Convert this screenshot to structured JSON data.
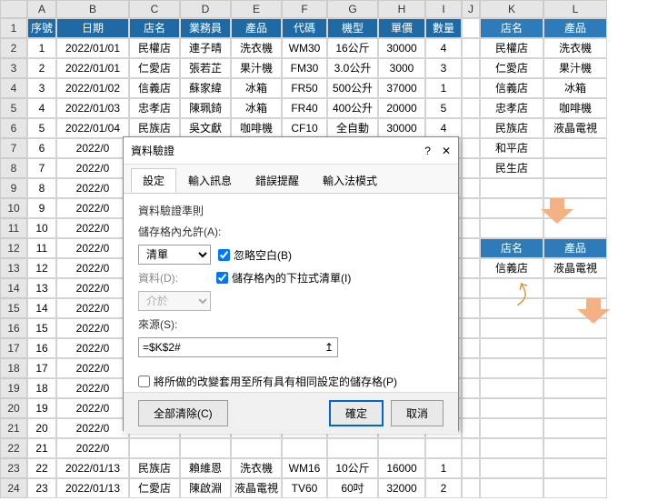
{
  "columns": [
    "A",
    "B",
    "C",
    "D",
    "E",
    "F",
    "G",
    "H",
    "I",
    "J",
    "K",
    "L"
  ],
  "headers": {
    "A": "序號",
    "B": "日期",
    "C": "店名",
    "D": "業務員",
    "E": "產品",
    "F": "代碼",
    "G": "機型",
    "H": "單價",
    "I": "數量"
  },
  "side_headers": {
    "K": "店名",
    "L": "產品"
  },
  "rows": [
    {
      "n": "1",
      "A": "1",
      "B": "2022/01/01",
      "C": "民權店",
      "D": "連子晴",
      "E": "洗衣機",
      "F": "WM30",
      "G": "16公斤",
      "H": "30000",
      "I": "4"
    },
    {
      "n": "2",
      "A": "2",
      "B": "2022/01/01",
      "C": "仁愛店",
      "D": "張若芷",
      "E": "果汁機",
      "F": "FM30",
      "G": "3.0公升",
      "H": "3000",
      "I": "3"
    },
    {
      "n": "3",
      "A": "3",
      "B": "2022/01/02",
      "C": "信義店",
      "D": "蘇家緯",
      "E": "冰箱",
      "F": "FR50",
      "G": "500公升",
      "H": "37000",
      "I": "1"
    },
    {
      "n": "4",
      "A": "4",
      "B": "2022/01/03",
      "C": "忠孝店",
      "D": "陳珮錡",
      "E": "冰箱",
      "F": "FR40",
      "G": "400公升",
      "H": "20000",
      "I": "5"
    },
    {
      "n": "5",
      "A": "5",
      "B": "2022/01/04",
      "C": "民族店",
      "D": "吳文獻",
      "E": "咖啡機",
      "F": "CF10",
      "G": "全自動",
      "H": "30000",
      "I": "4"
    },
    {
      "n": "6",
      "A": "6",
      "B": "2022/0"
    },
    {
      "n": "7",
      "A": "7",
      "B": "2022/0"
    },
    {
      "n": "8",
      "A": "8",
      "B": "2022/0"
    },
    {
      "n": "9",
      "A": "9",
      "B": "2022/0"
    },
    {
      "n": "10",
      "A": "10",
      "B": "2022/0"
    },
    {
      "n": "11",
      "A": "11",
      "B": "2022/0"
    },
    {
      "n": "12",
      "A": "12",
      "B": "2022/0"
    },
    {
      "n": "13",
      "A": "13",
      "B": "2022/0"
    },
    {
      "n": "14",
      "A": "14",
      "B": "2022/0"
    },
    {
      "n": "15",
      "A": "15",
      "B": "2022/0"
    },
    {
      "n": "16",
      "A": "16",
      "B": "2022/0"
    },
    {
      "n": "17",
      "A": "17",
      "B": "2022/0"
    },
    {
      "n": "18",
      "A": "18",
      "B": "2022/0"
    },
    {
      "n": "19",
      "A": "19",
      "B": "2022/0"
    },
    {
      "n": "20",
      "A": "20",
      "B": "2022/0"
    },
    {
      "n": "21",
      "A": "21",
      "B": "2022/0"
    },
    {
      "n": "22",
      "A": "22",
      "B": "2022/01/13",
      "C": "民族店",
      "D": "賴維恩",
      "E": "洗衣機",
      "F": "WM16",
      "G": "10公斤",
      "H": "16000",
      "I": "1"
    },
    {
      "n": "23",
      "A": "23",
      "B": "2022/01/13",
      "C": "仁愛店",
      "D": "陳啟淵",
      "E": "液晶電視",
      "F": "TV60",
      "G": "60吋",
      "H": "32000",
      "I": "2"
    }
  ],
  "side_list": [
    {
      "K": "民權店",
      "L": "洗衣機"
    },
    {
      "K": "仁愛店",
      "L": "果汁機"
    },
    {
      "K": "信義店",
      "L": "冰箱"
    },
    {
      "K": "忠孝店",
      "L": "咖啡機"
    },
    {
      "K": "民族店",
      "L": "液晶電視"
    },
    {
      "K": "和平店",
      "L": ""
    },
    {
      "K": "民生店",
      "L": ""
    }
  ],
  "side_result_header": {
    "K": "店名",
    "L": "產品"
  },
  "side_result": {
    "K": "信義店",
    "L": "液晶電視"
  },
  "dialog": {
    "title": "資料驗證",
    "help": "?",
    "close": "✕",
    "tabs": {
      "t1": "設定",
      "t2": "輸入訊息",
      "t3": "錯誤提醒",
      "t4": "輸入法模式"
    },
    "rule_label": "資料驗證準則",
    "allow_label": "儲存格內允許(A):",
    "allow_value": "清單",
    "ignore_blank": "忽略空白(B)",
    "dropdown_in_cell": "儲存格內的下拉式清單(I)",
    "data_label": "資料(D):",
    "data_value": "介於",
    "source_label": "來源(S):",
    "source_value": "=$K$2#",
    "apply_all": "將所做的改變套用至所有具有相同設定的儲存格(P)",
    "clear_all": "全部清除(C)",
    "ok": "確定",
    "cancel": "取消"
  }
}
